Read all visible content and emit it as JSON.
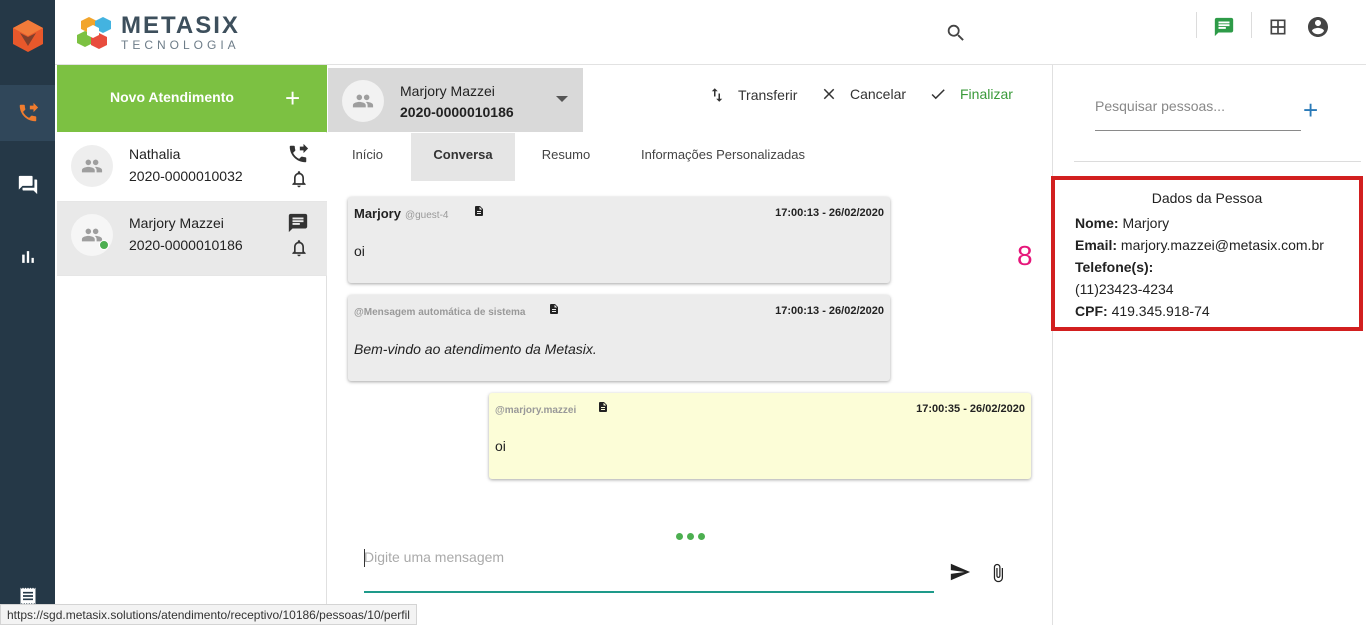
{
  "brand": {
    "name": "METASIX",
    "subtitle": "TECNOLOGIA"
  },
  "sidebar": {
    "items": [
      {
        "icon": "phone-forward-icon",
        "active": true
      },
      {
        "icon": "chat-icon",
        "active": false
      },
      {
        "icon": "bar-chart-icon",
        "active": false
      },
      {
        "icon": "receipt-icon",
        "active": false
      }
    ]
  },
  "left": {
    "new_button_label": "Novo Atendimento",
    "contacts": [
      {
        "name": "Nathalia",
        "protocol": "2020-0000010032",
        "channel_icon": "phone-forward-icon"
      },
      {
        "name": "Marjory Mazzei",
        "protocol": "2020-0000010186",
        "channel_icon": "chat-icon",
        "online": true
      }
    ]
  },
  "conversation": {
    "name": "Marjory Mazzei",
    "protocol": "2020-0000010186",
    "actions": {
      "transfer": "Transferir",
      "cancel": "Cancelar",
      "finish": "Finalizar"
    },
    "tabs": [
      "Início",
      "Conversa",
      "Resumo",
      "Informações Personalizadas"
    ],
    "active_tab": "Conversa",
    "messages": [
      {
        "sender": "Marjory",
        "handle": "@guest-4",
        "time": "17:00:13 - 26/02/2020",
        "text": "oi"
      },
      {
        "sender": "",
        "handle": "@Mensagem automática de sistema",
        "time": "17:00:13 - 26/02/2020",
        "text": "Bem-vindo ao atendimento da Metasix."
      },
      {
        "sender": "",
        "handle": "@marjory.mazzei",
        "time": "17:00:35 - 26/02/2020",
        "text": "oi"
      }
    ],
    "composer_placeholder": "Digite uma mensagem"
  },
  "right": {
    "search_placeholder": "Pesquisar pessoas...",
    "person": {
      "title": "Dados da Pessoa",
      "name_label": "Nome:",
      "name": "Marjory",
      "email_label": "Email:",
      "email": "marjory.mazzei@metasix.com.br",
      "phone_label": "Telefone(s):",
      "phone": "(11)23423-4234",
      "cpf_label": "CPF:",
      "cpf": "419.345.918-74"
    }
  },
  "annotation_number": "8",
  "status_url": "https://sgd.metasix.solutions/atendimento/receptivo/10186/pessoas/10/perfil",
  "colors": {
    "rail": "#253847",
    "accent_green": "#7cc142",
    "highlight_red": "#d21f1f",
    "composer_line": "#1e9a8a"
  }
}
